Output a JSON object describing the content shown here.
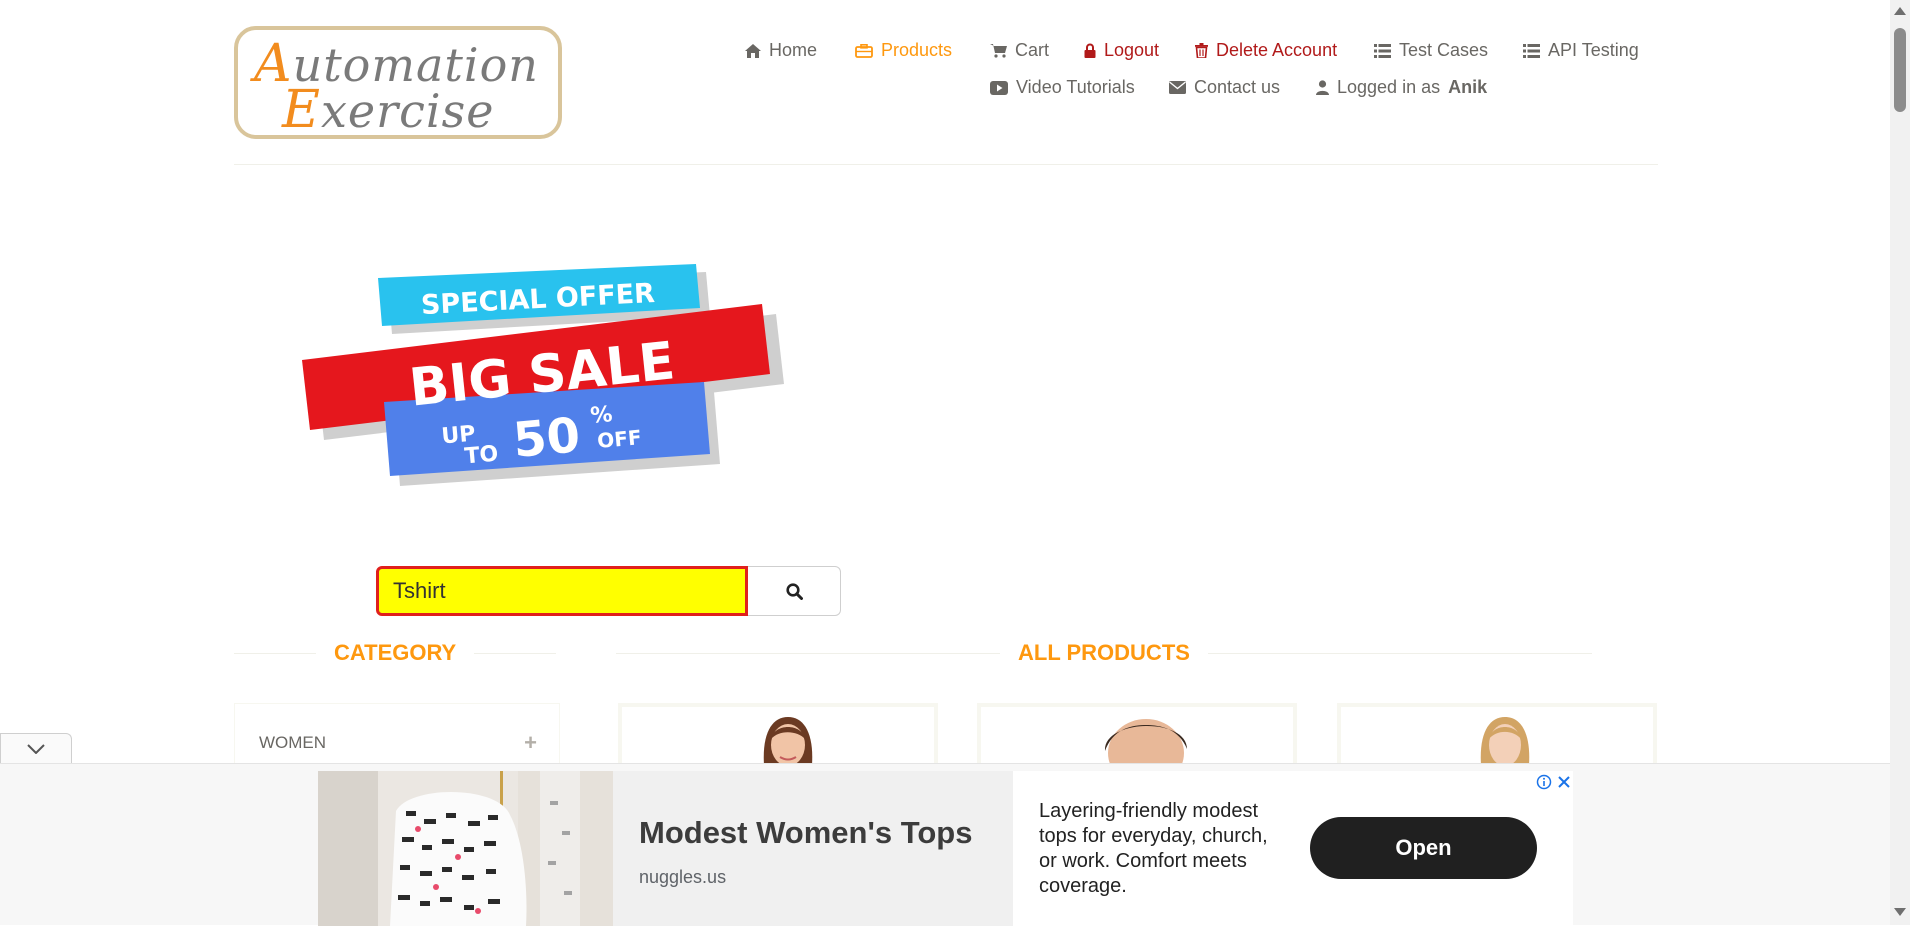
{
  "logo": {
    "line1_cap": "A",
    "line1_rest": "utomation",
    "line2_cap": "E",
    "line2_rest": "xercise"
  },
  "nav": {
    "home": "Home",
    "products": "Products",
    "cart": "Cart",
    "logout": "Logout",
    "delete_account": "Delete Account",
    "test_cases": "Test Cases",
    "api_testing": "API Testing",
    "video_tutorials": "Video Tutorials",
    "contact_us": "Contact us",
    "logged_in_prefix": "Logged in as",
    "logged_in_user": "Anik"
  },
  "banner": {
    "line1": "SPECIAL OFFER",
    "line2": "BIG SALE",
    "up": "UP",
    "to": "TO",
    "percent": "50",
    "percent_sign": "%",
    "off": "OFF"
  },
  "search": {
    "value": "Tshirt",
    "button_icon": "search-icon"
  },
  "sections": {
    "category_title": "CATEGORY",
    "products_title": "ALL PRODUCTS"
  },
  "categories": [
    {
      "label": "WOMEN",
      "expand_icon": "+"
    }
  ],
  "ad": {
    "title": "Modest Women's Tops",
    "domain": "nuggles.us",
    "description": "Layering-friendly modest tops for everyday, church, or work. Comfort meets coverage.",
    "cta": "Open"
  },
  "colors": {
    "accent": "#FE980F",
    "danger": "#B11A1A",
    "search_bg": "#FFFF00",
    "search_border": "#E0201C"
  }
}
